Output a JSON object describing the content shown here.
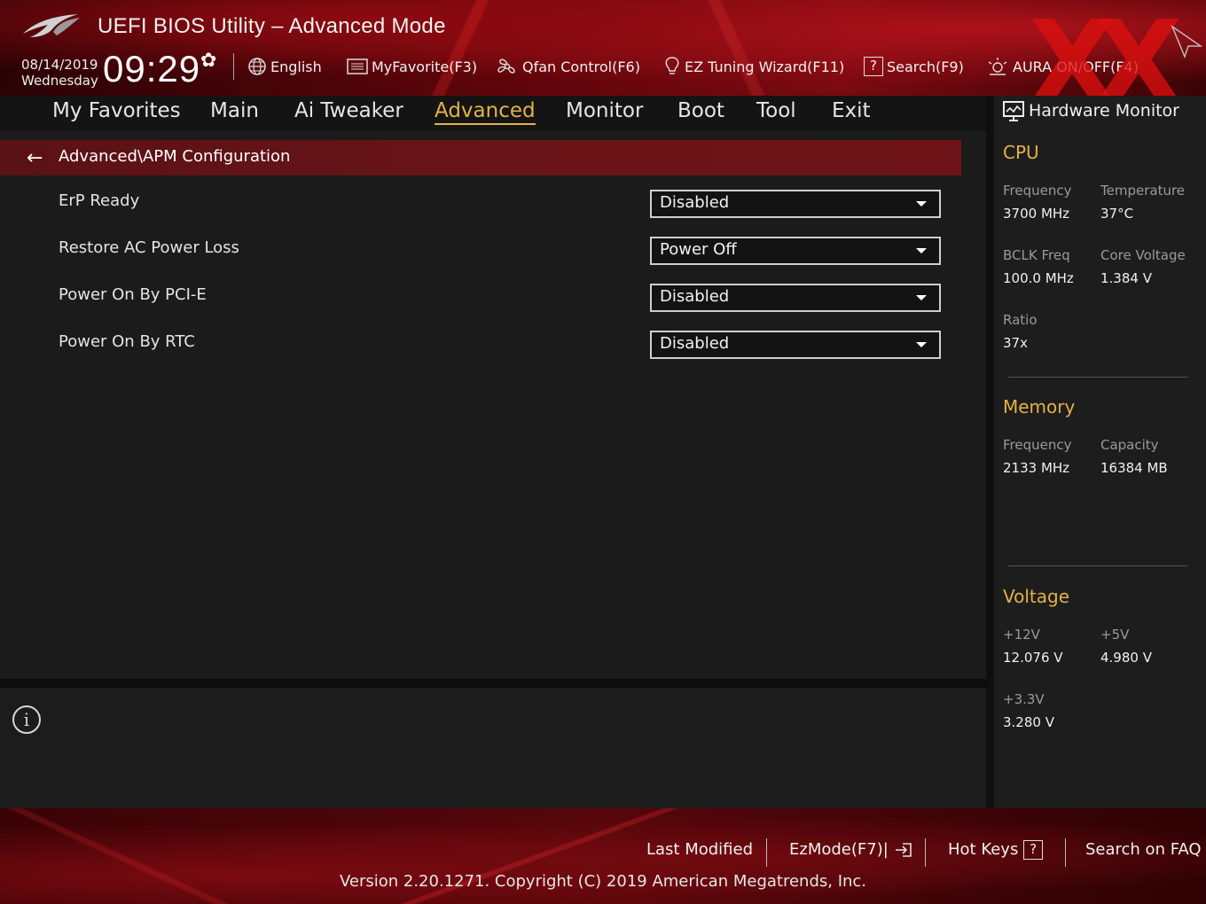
{
  "header": {
    "title": "UEFI BIOS Utility – Advanced Mode",
    "date": "08/14/2019",
    "weekday": "Wednesday",
    "time": "09:29"
  },
  "toolbar": {
    "language": "English",
    "myfavorite": "MyFavorite(F3)",
    "qfan": "Qfan Control(F6)",
    "ez_tuning": "EZ Tuning Wizard(F11)",
    "search": "Search(F9)",
    "aura": "AURA ON/OFF(F4)"
  },
  "nav": {
    "tabs": [
      "My Favorites",
      "Main",
      "Ai Tweaker",
      "Advanced",
      "Monitor",
      "Boot",
      "Tool",
      "Exit"
    ],
    "active": "Advanced"
  },
  "breadcrumb": "Advanced\\APM Configuration",
  "settings": [
    {
      "label": "ErP Ready",
      "value": "Disabled"
    },
    {
      "label": "Restore AC Power Loss",
      "value": "Power Off"
    },
    {
      "label": "Power On By PCI-E",
      "value": "Disabled"
    },
    {
      "label": "Power On By RTC",
      "value": "Disabled"
    }
  ],
  "hw_monitor": {
    "title": "Hardware Monitor",
    "cpu": {
      "heading": "CPU",
      "frequency_label": "Frequency",
      "frequency": "3700 MHz",
      "temperature_label": "Temperature",
      "temperature": "37°C",
      "bclk_label": "BCLK Freq",
      "bclk": "100.0 MHz",
      "core_voltage_label": "Core Voltage",
      "core_voltage": "1.384 V",
      "ratio_label": "Ratio",
      "ratio": "37x"
    },
    "memory": {
      "heading": "Memory",
      "frequency_label": "Frequency",
      "frequency": "2133 MHz",
      "capacity_label": "Capacity",
      "capacity": "16384 MB"
    },
    "voltage": {
      "heading": "Voltage",
      "v12_label": "+12V",
      "v12": "12.076 V",
      "v5_label": "+5V",
      "v5": "4.980 V",
      "v33_label": "+3.3V",
      "v33": "3.280 V"
    }
  },
  "footer": {
    "last_modified": "Last Modified",
    "ezmode": "EzMode(F7)|",
    "hot_keys": "Hot Keys",
    "search_faq": "Search on FAQ",
    "version": "Version 2.20.1271. Copyright (C) 2019 American Megatrends, Inc."
  },
  "colors": {
    "accent": "#e2b247",
    "breadcrumb_bg": "#5a1216",
    "panel_bg": "#1b1b1b"
  },
  "icons": [
    "rog-logo-icon",
    "gear-icon",
    "globe-icon",
    "favorite-list-icon",
    "fan-icon",
    "lightbulb-icon",
    "help-box-icon",
    "aura-light-icon",
    "back-arrow-icon",
    "monitor-icon",
    "info-icon",
    "exit-arrow-icon",
    "question-box-icon"
  ]
}
